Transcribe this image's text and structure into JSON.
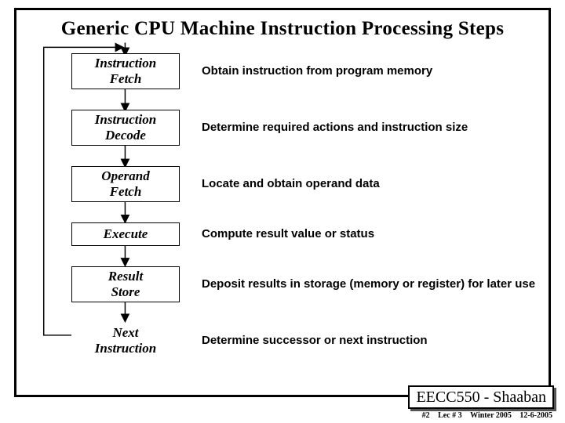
{
  "title": "Generic CPU Machine Instruction Processing Steps",
  "steps": [
    {
      "line1": "Instruction",
      "line2": "Fetch",
      "desc": "Obtain instruction from program memory"
    },
    {
      "line1": "Instruction",
      "line2": "Decode",
      "desc": "Determine required actions and instruction size"
    },
    {
      "line1": "Operand",
      "line2": "Fetch",
      "desc": "Locate and obtain operand data"
    },
    {
      "line1": "Execute",
      "line2": "",
      "desc": "Compute result value or status"
    },
    {
      "line1": "Result",
      "line2": "Store",
      "desc": "Deposit results in storage (memory or register) for later use"
    },
    {
      "line1": "Next",
      "line2": "Instruction",
      "desc": "Determine successor or next instruction"
    }
  ],
  "footer": {
    "course": "EECC550 - Shaaban",
    "slide": "#2",
    "lecture": "Lec # 3",
    "term": "Winter 2005",
    "date": "12-6-2005"
  }
}
